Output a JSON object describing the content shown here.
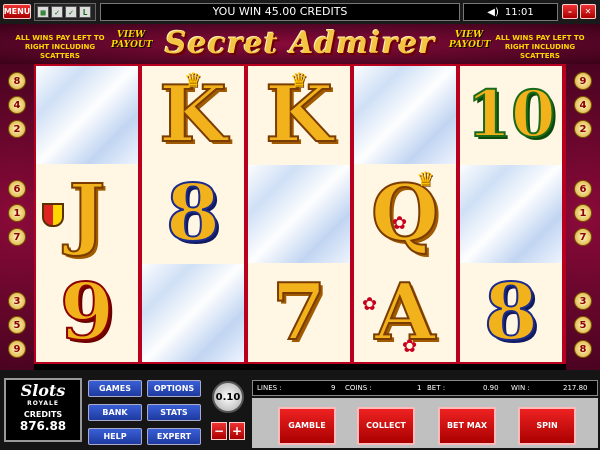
{
  "topbar": {
    "menu_label": "MENU",
    "message": "YOU WIN 45.00 CREDITS",
    "time": "11:01",
    "min_label": "–",
    "close_label": "✕"
  },
  "banner": {
    "title": "Secret Admirer",
    "rule_left": "ALL WINS PAY LEFT TO RIGHT INCLUDING SCATTERS",
    "rule_right": "ALL WINS PAY LEFT TO RIGHT INCLUDING SCATTERS",
    "view_payout_left": "VIEW PAYOUT",
    "view_payout_right": "VIEW PAYOUT"
  },
  "paylines": {
    "left": [
      "8",
      "4",
      "2",
      "6",
      "1",
      "7",
      "3",
      "5",
      "9"
    ],
    "right": [
      "9",
      "4",
      "2",
      "6",
      "1",
      "7",
      "3",
      "5",
      "8"
    ]
  },
  "reels": [
    [
      "diamond",
      "J",
      "9"
    ],
    [
      "K",
      "8",
      "diamond"
    ],
    [
      "K",
      "diamond",
      "7"
    ],
    [
      "diamond",
      "Q",
      "A"
    ],
    [
      "10",
      "diamond",
      "8"
    ]
  ],
  "logo": {
    "main": "Slots",
    "sub": "ROYALE",
    "credits_label": "CREDITS",
    "credits_value": "876.88"
  },
  "nav": {
    "games": "GAMES",
    "options": "OPTIONS",
    "bank": "BANK",
    "stats": "STATS",
    "help": "HELP",
    "expert": "EXPERT"
  },
  "coin_value": "0.10",
  "stats": {
    "lines_label": "LINES :",
    "lines_value": "9",
    "coins_label": "COINS :",
    "coins_value": "1",
    "bet_label": "BET :",
    "bet_value": "0.90",
    "win_label": "WIN :",
    "win_value": "217.80"
  },
  "actions": {
    "gamble": "GAMBLE",
    "collect": "COLLECT",
    "bet_max": "BET MAX",
    "spin": "SPIN"
  }
}
